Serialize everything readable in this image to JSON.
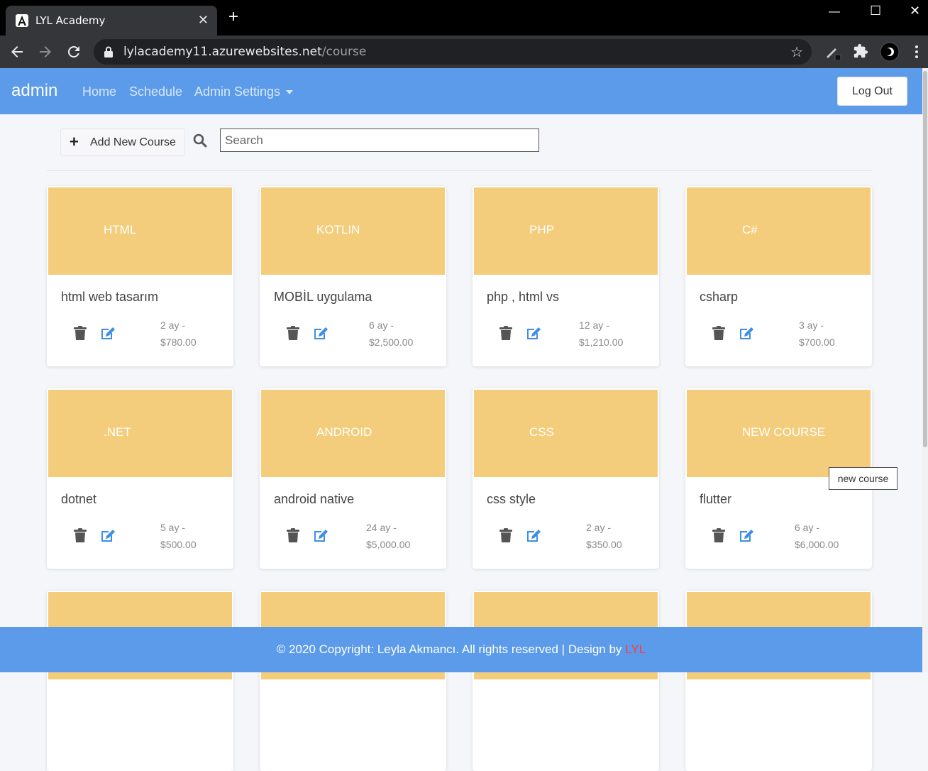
{
  "browser": {
    "tab_title": "LYL Academy",
    "url_host": "lylacademy11.azurewebsites.net",
    "url_path": "/course"
  },
  "navbar": {
    "brand": "admin",
    "links": [
      "Home",
      "Schedule",
      "Admin Settings"
    ],
    "logout_label": "Log Out"
  },
  "toolbar": {
    "add_label": "Add New Course",
    "search_placeholder": "Search"
  },
  "courses": [
    {
      "tag": "HTML",
      "title": "html web tasarım",
      "duration": "2 ay -",
      "price": "$780.00"
    },
    {
      "tag": "KOTLIN",
      "title": "MOBİL uygulama",
      "duration": "6 ay -",
      "price": "$2,500.00"
    },
    {
      "tag": "PHP",
      "title": "php , html vs",
      "duration": "12 ay -",
      "price": "$1,210.00"
    },
    {
      "tag": "C#",
      "title": "csharp",
      "duration": "3 ay -",
      "price": "$700.00"
    },
    {
      "tag": ".NET",
      "title": "dotnet",
      "duration": "5 ay -",
      "price": "$500.00"
    },
    {
      "tag": "ANDROID",
      "title": "android native",
      "duration": "24 ay -",
      "price": "$5,000.00"
    },
    {
      "tag": "CSS",
      "title": "css style",
      "duration": "2 ay -",
      "price": "$350.00"
    },
    {
      "tag": "NEW COURSE",
      "title": "flutter",
      "duration": "6 ay -",
      "price": "$6,000.00"
    }
  ],
  "tooltip": "new course",
  "footer": {
    "text": "© 2020 Copyright: Leyla Akmancı. All rights reserved | Design by ",
    "brand": "LYL"
  },
  "colors": {
    "navbar": "#5b9bea",
    "card_header": "#f3cd7b",
    "footer_brand": "#ff3b3b"
  }
}
